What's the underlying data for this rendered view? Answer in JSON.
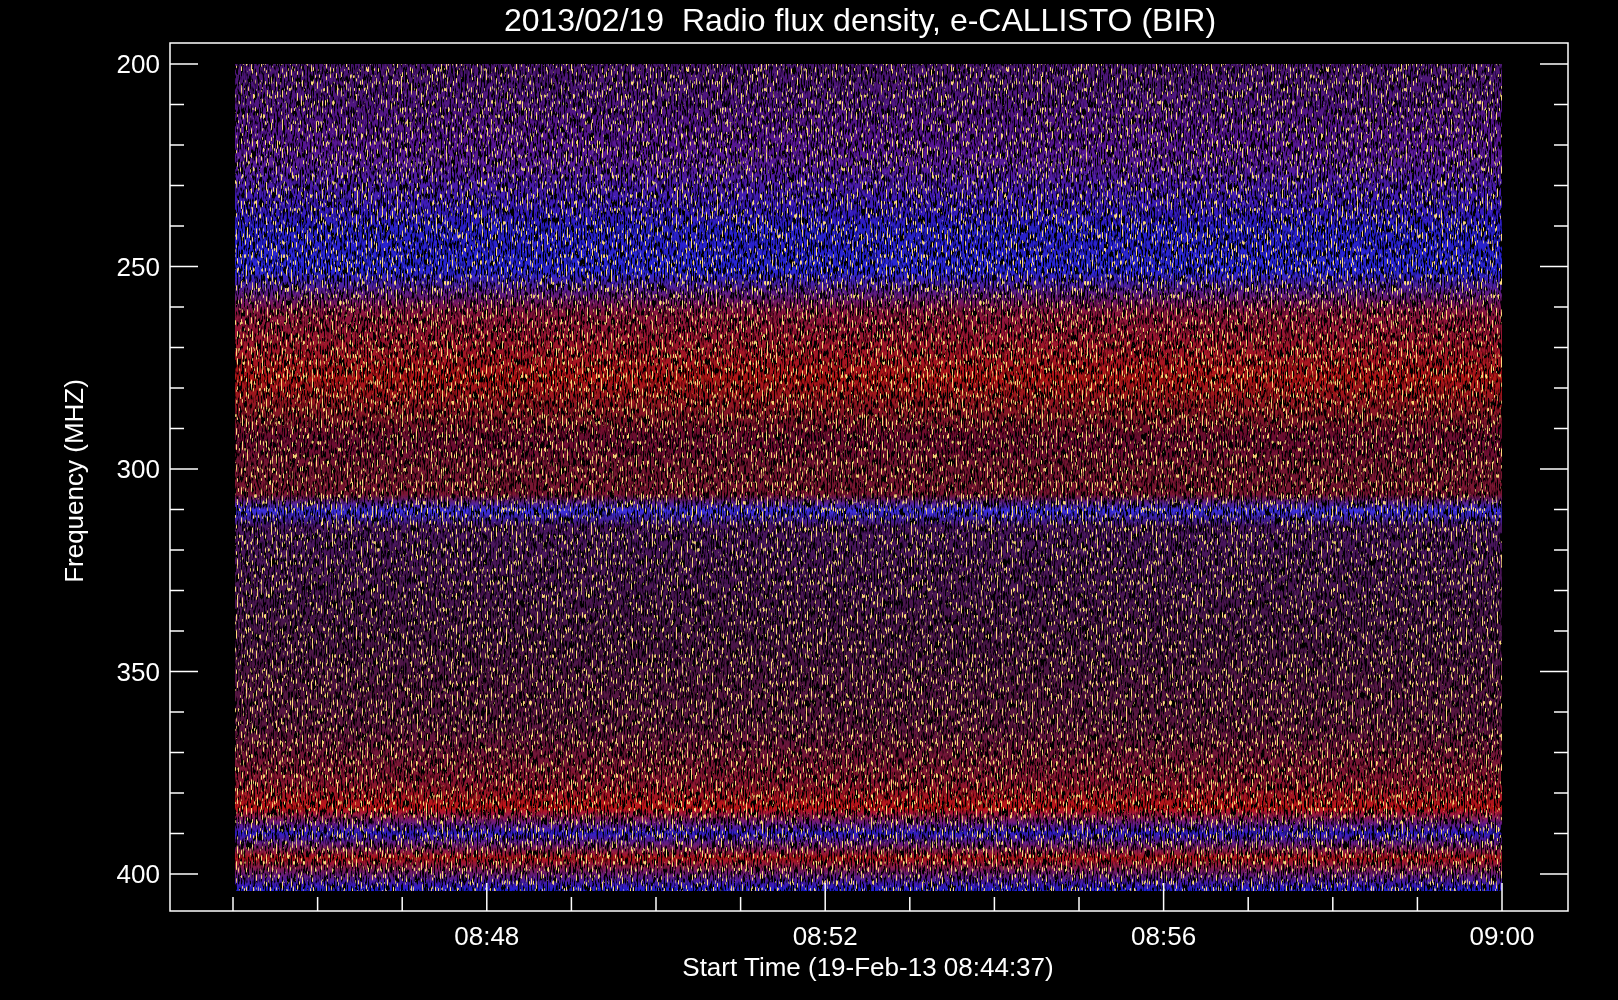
{
  "title": "2013/02/19  Radio flux density, e-CALLISTO (BIR)",
  "y_axis": {
    "label": "Frequency (MHZ)",
    "ticks": [
      "200",
      "250",
      "300",
      "350",
      "400"
    ]
  },
  "x_axis": {
    "label": "Start Time (19-Feb-13 08:44:37)",
    "ticks": [
      "08:48",
      "08:52",
      "08:56",
      "09:00"
    ]
  }
}
